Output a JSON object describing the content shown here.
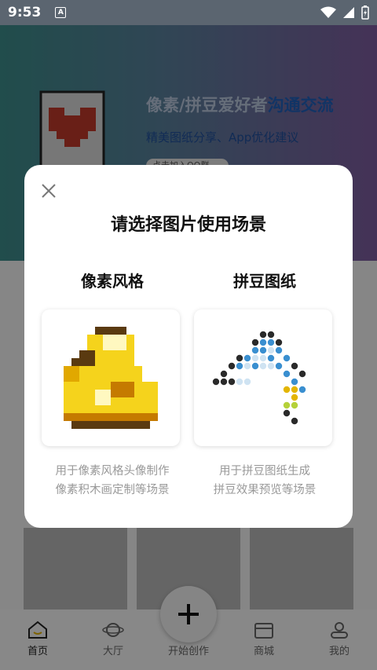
{
  "status_bar": {
    "time": "9:53",
    "badge": "A"
  },
  "banner": {
    "title_part1": "像素/拼豆爱好者",
    "title_part2": "沟通交流",
    "subtitle": "精美图纸分享、App优化建议",
    "pill": "点击加入QQ群"
  },
  "dialog": {
    "title": "请选择图片使用场景",
    "options": [
      {
        "label": "像素风格",
        "desc_line1": "用于像素风格头像制作",
        "desc_line2": "像素积木画定制等场景"
      },
      {
        "label": "拼豆图纸",
        "desc_line1": "用于拼豆图纸生成",
        "desc_line2": "拼豆效果预览等场景"
      }
    ]
  },
  "bottom_nav": {
    "items": [
      {
        "label": "首页",
        "icon": "home-icon"
      },
      {
        "label": "大厅",
        "icon": "planet-icon"
      },
      {
        "label": "开始创作",
        "icon": "plus-icon"
      },
      {
        "label": "商城",
        "icon": "shop-icon"
      },
      {
        "label": "我的",
        "icon": "user-icon"
      }
    ]
  },
  "colors": {
    "accent_blue": "#1f5fb8",
    "banner_start": "#3c8c8a",
    "banner_end": "#7e5c9e"
  }
}
